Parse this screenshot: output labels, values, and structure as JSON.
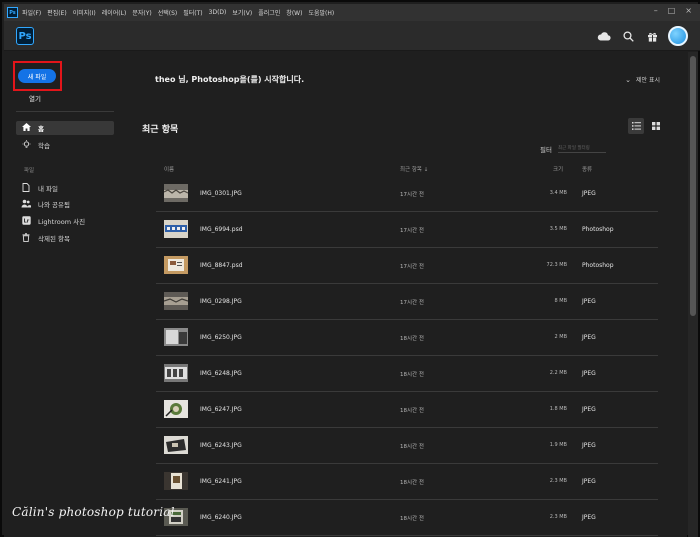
{
  "menubar": {
    "app_icon": "Ps",
    "items": [
      "파일(F)",
      "편집(E)",
      "이미지(I)",
      "레이어(L)",
      "문자(Y)",
      "선택(S)",
      "필터(T)",
      "3D(D)",
      "보기(V)",
      "플러그인",
      "창(W)",
      "도움말(H)"
    ],
    "minimize": "–",
    "maximize": "□",
    "close": "×"
  },
  "toolbar": {
    "logo": "Ps",
    "icons": [
      "cloud-icon",
      "search-icon",
      "gift-icon",
      "avatar"
    ]
  },
  "sidebar": {
    "new_file": "새 파일",
    "open": "열기",
    "home": "홈",
    "learn": "학습",
    "files_section": "파일",
    "my_files": "내 파일",
    "shared": "나와 공유됨",
    "lightroom": "Lightroom 사진",
    "deleted": "삭제된 항목"
  },
  "main": {
    "welcome": "theo 님, Photoshop을(를) 시작합니다.",
    "suggest": "제안 표시",
    "recent_title": "최근 항목",
    "filter_label": "필터",
    "filter_placeholder": "최근 파일 필터링",
    "columns": {
      "name": "이름",
      "recent": "최근 항목 ↓",
      "size": "크기",
      "kind": "종류"
    },
    "files": [
      {
        "name": "IMG_0301.JPG",
        "time": "17시간 전",
        "size": "3.4 MB",
        "kind": "JPEG"
      },
      {
        "name": "IMG_6994.psd",
        "time": "17시간 전",
        "size": "3.5 MB",
        "kind": "Photoshop"
      },
      {
        "name": "IMG_8847.psd",
        "time": "17시간 전",
        "size": "72.3 MB",
        "kind": "Photoshop"
      },
      {
        "name": "IMG_0298.JPG",
        "time": "17시간 전",
        "size": "8 MB",
        "kind": "JPEG"
      },
      {
        "name": "IMG_6250.JPG",
        "time": "18시간 전",
        "size": "2 MB",
        "kind": "JPEG"
      },
      {
        "name": "IMG_6248.JPG",
        "time": "18시간 전",
        "size": "2.2 MB",
        "kind": "JPEG"
      },
      {
        "name": "IMG_6247.JPG",
        "time": "18시간 전",
        "size": "1.8 MB",
        "kind": "JPEG"
      },
      {
        "name": "IMG_6243.JPG",
        "time": "18시간 전",
        "size": "1.9 MB",
        "kind": "JPEG"
      },
      {
        "name": "IMG_6241.JPG",
        "time": "18시간 전",
        "size": "2.3 MB",
        "kind": "JPEG"
      },
      {
        "name": "IMG_6240.JPG",
        "time": "18시간 전",
        "size": "2.3 MB",
        "kind": "JPEG"
      }
    ]
  },
  "watermark": "Călin's photoshop tutorial",
  "colors": {
    "accent": "#1473e6",
    "highlight": "#e3151a",
    "background": "#1f1f1f"
  }
}
